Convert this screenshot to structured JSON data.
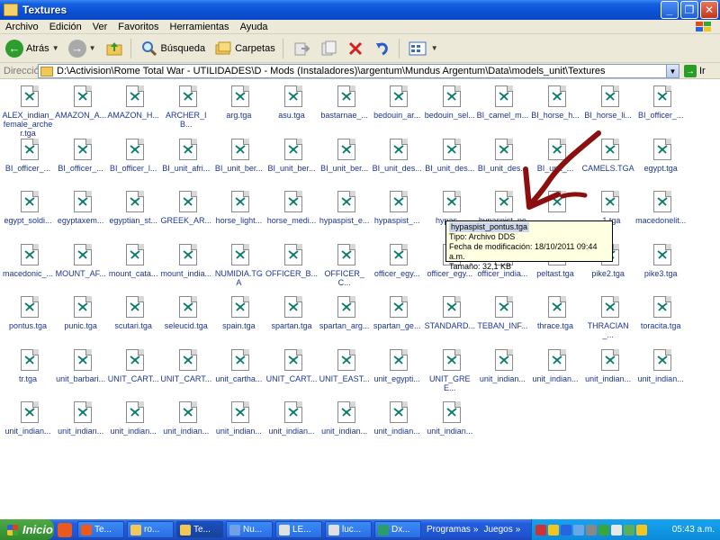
{
  "window": {
    "title": "Textures"
  },
  "menu": [
    "Archivo",
    "Edición",
    "Ver",
    "Favoritos",
    "Herramientas",
    "Ayuda"
  ],
  "toolbar": {
    "back_label": "Atrás",
    "search_label": "Búsqueda",
    "folders_label": "Carpetas"
  },
  "address": {
    "label": "Dirección",
    "path": "D:\\Activision\\Rome Total War - UTILIDADES\\D - Mods (Instaladores)\\argentum\\Mundus Argentum\\Data\\models_unit\\Textures",
    "go_label": "Ir"
  },
  "files": [
    "ALEX_indian_female_archer.tga",
    "AMAZON_A...",
    "AMAZON_H...",
    "ARCHER_IB...",
    "arg.tga",
    "asu.tga",
    "bastarnae_...",
    "bedouin_ar...",
    "bedouin_sel...",
    "BI_camel_m...",
    "BI_horse_h...",
    "BI_horse_li...",
    "BI_officer_...",
    "BI_officer_...",
    "BI_officer_...",
    "BI_officer_l...",
    "BI_unit_afri...",
    "BI_unit_ber...",
    "BI_unit_ber...",
    "BI_unit_ber...",
    "BI_unit_des...",
    "BI_unit_des...",
    "BI_unit_des...",
    "BI_unit_...",
    "CAMELS.TGA",
    "egypt.tga",
    "egypt_soldi...",
    "egyptaxem...",
    "egyptian_st...",
    "GREEK_AR...",
    "horse_light...",
    "horse_medi...",
    "hypaspist_e...",
    "hypaspist_...",
    "hypas...",
    "hypaspist_pontus.tga",
    "",
    "...1.tga",
    "macedonelit...",
    "macedonic_...",
    "MOUNT_AF...",
    "mount_cata...",
    "mount_india...",
    "NUMIDIA.TGA",
    "OFFICER_B...",
    "OFFICER_C...",
    "officer_egy...",
    "officer_egy...",
    "officer_india...",
    "peltast.tga",
    "pike2.tga",
    "pike3.tga",
    "pontus.tga",
    "punic.tga",
    "scutari.tga",
    "seleucid.tga",
    "spain.tga",
    "spartan.tga",
    "spartan_arg...",
    "spartan_ge...",
    "STANDARD...",
    "TEBAN_INF...",
    "thrace.tga",
    "THRACIAN_...",
    "toracita.tga",
    "tr.tga",
    "unit_barbari...",
    "UNIT_CART...",
    "UNIT_CART...",
    "unit_cartha...",
    "UNIT_CART...",
    "UNIT_EAST...",
    "unit_egypti...",
    "UNIT_GREE...",
    "unit_indian...",
    "unit_indian...",
    "unit_indian...",
    "unit_indian...",
    "unit_indian...",
    "unit_indian...",
    "unit_indian...",
    "unit_indian...",
    "unit_indian...",
    "unit_indian...",
    "unit_indian...",
    "unit_indian...",
    "unit_indian..."
  ],
  "tooltip": {
    "name": "hypaspist_pontus.tga",
    "type": "Tipo: Archivo DDS",
    "modified": "Fecha de modificación: 18/10/2011 09:44 a.m.",
    "size": "Tamaño: 32,1 KB"
  },
  "taskbar": {
    "start_label": "Inicio",
    "tasks": [
      "Te...",
      "ro...",
      "Te...",
      "Nu...",
      "LE...",
      "luc...",
      "Dx..."
    ],
    "groups": [
      "Programas",
      "Juegos"
    ],
    "clock": "05:43 a.m."
  },
  "colors": {
    "titlebar": "#0a50d4",
    "file_label": "#1c3590",
    "tooltip_bg": "#ffffe1",
    "arrow": "#8b0f0f"
  }
}
